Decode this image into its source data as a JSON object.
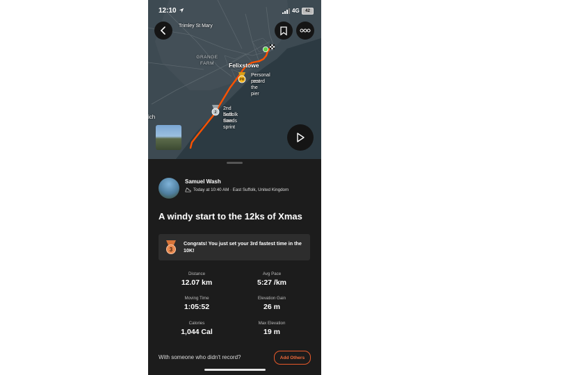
{
  "status_bar": {
    "time": "12:10",
    "network": "4G",
    "battery": "42"
  },
  "map": {
    "labels": {
      "trimley": "Trimley St Mary",
      "grange_farm": "GRANGE\nFARM",
      "felixstowe": "Felixstowe",
      "edge_text": "ich"
    },
    "pins": [
      {
        "line1": "Personal record",
        "line2": "past the pier"
      },
      {
        "line1": "2nd best time",
        "line2": "Suffolk Sands sprint"
      }
    ],
    "icons": {
      "back": "chevron-left-icon",
      "bookmark": "bookmark-icon",
      "more": "more-icon",
      "play": "play-icon"
    },
    "route_color": "#fc5200"
  },
  "activity": {
    "athlete_name": "Samuel Wash",
    "meta": "Today at 10:40 AM · East Suffolk, United Kingdom",
    "title": "A windy start to the 12ks of Xmas",
    "achievement": "Congrats! You just set your 3rd fastest time in the 10K!",
    "achievement_rank": "3",
    "stats": [
      {
        "label": "Distance",
        "value": "12.07 km"
      },
      {
        "label": "Avg Pace",
        "value": "5:27 /km"
      },
      {
        "label": "Moving Time",
        "value": "1:05:52"
      },
      {
        "label": "Elevation Gain",
        "value": "26 m"
      },
      {
        "label": "Calories",
        "value": "1,044 Cal"
      },
      {
        "label": "Max Elevation",
        "value": "19 m"
      }
    ],
    "with_others_prompt": "With someone who didn't record?",
    "add_others_label": "Add Others"
  },
  "colors": {
    "accent": "#fc5200",
    "sheet_bg": "#1c1c1c",
    "map_water": "#2c3a42"
  }
}
